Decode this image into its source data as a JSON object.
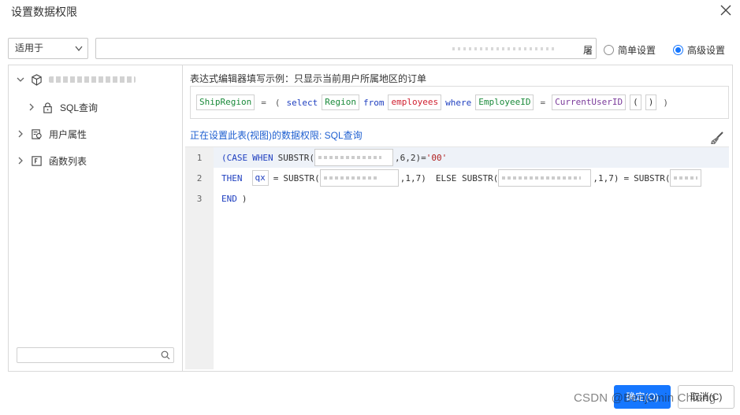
{
  "dialog": {
    "title": "设置数据权限",
    "close_icon": "close-icon"
  },
  "toolbar": {
    "scope_select": {
      "value": "适用于"
    },
    "expression_field": {
      "tail_text": "屠"
    },
    "modes": [
      {
        "label": "简单设置",
        "selected": false
      },
      {
        "label": "高级设置",
        "selected": true
      }
    ]
  },
  "tree": {
    "items": [
      {
        "label": "SQL查询",
        "icon": "lock-icon"
      },
      {
        "label": "用户属性",
        "icon": "user-attr-icon"
      },
      {
        "label": "函数列表",
        "icon": "function-list-icon"
      }
    ],
    "search_icon": "search-icon"
  },
  "editor_panel": {
    "hint": "表达式编辑器填写示例：只显示当前用户所属地区的订单",
    "example": {
      "tokens": [
        "ShipRegion",
        "=",
        "(",
        "select",
        "Region",
        "from",
        "employees",
        "where",
        "EmployeeID",
        "=",
        "CurrentUserID",
        "(",
        ")",
        ")"
      ]
    },
    "setting_label": "正在设置此表(视图)的数据权限: SQL查询",
    "brush_icon": "brush-icon",
    "code": {
      "line_numbers": [
        "1",
        "2",
        "3"
      ],
      "line1": {
        "a": "(CASE",
        "b": "WHEN",
        "c": "SUBSTR(",
        "d": ",6,2)=",
        "e": "'00'"
      },
      "line2": {
        "a": "THEN",
        "b": "qx",
        "c": "=",
        "d": "SUBSTR(",
        "e": ",1,7)",
        "f": "ELSE SUBSTR(",
        "g": ",1,7)",
        "h": "=",
        "i": "SUBSTR("
      },
      "line3": {
        "a": "END",
        "b": ")"
      }
    }
  },
  "footer": {
    "ok_label": "确定(O)",
    "cancel_label": "取消(C)",
    "watermark": "CSDN @Benjamin Chiang"
  },
  "colors": {
    "accent": "#1677ff",
    "setting_text": "#1e5fd0"
  }
}
